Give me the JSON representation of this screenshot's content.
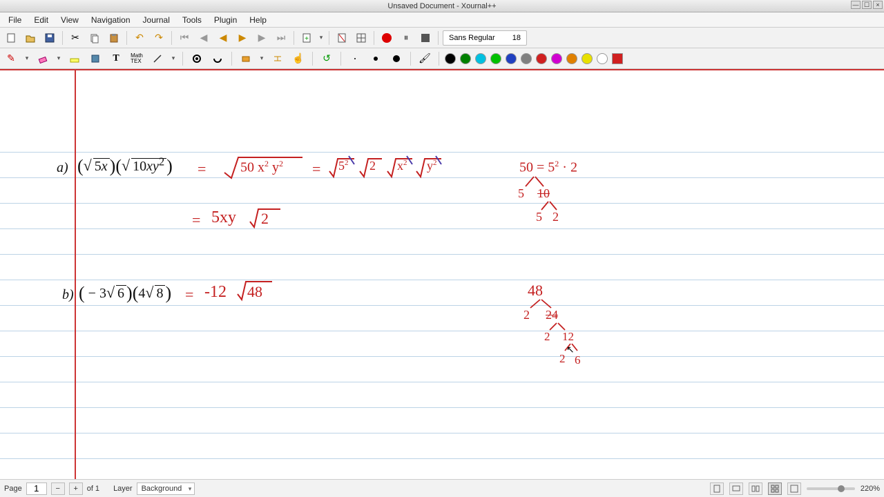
{
  "window": {
    "title": "Unsaved Document - Xournal++",
    "min": "—",
    "max": "☐",
    "close": "×"
  },
  "menu": {
    "file": "File",
    "edit": "Edit",
    "view": "View",
    "navigation": "Navigation",
    "journal": "Journal",
    "tools": "Tools",
    "plugin": "Plugin",
    "help": "Help"
  },
  "toolbar": {
    "font_name": "Sans Regular",
    "font_size": "18"
  },
  "colors": {
    "palette": [
      "#000000",
      "#008000",
      "#00c0c0",
      "#00a000",
      "#0030c0",
      "#808080",
      "#d02020",
      "#d000c0",
      "#e08000",
      "#e0d000",
      "#ffffff"
    ],
    "fill": "#d02020"
  },
  "status": {
    "page_label": "Page",
    "page_current": "1",
    "page_total": "of 1",
    "layer_label": "Layer",
    "layer_name": "Background",
    "zoom": "220%"
  },
  "content": {
    "problem_a_label": "a)",
    "problem_a_expr": "(√5x)(√10xy²)",
    "problem_b_label": "b)",
    "problem_b_expr": "(− 3√6)(4√8)",
    "eq": "=",
    "a_step1": "√(50 x² y²)",
    "a_step2": "√5² √2 √x² √y²",
    "a_step3": "5xy √2",
    "a_side1": "50 = 5² · 2",
    "a_side2a": "5",
    "a_side2b": "10",
    "a_side3a": "5",
    "a_side3b": "2",
    "b_step1": "-12 √48",
    "b_side1": "48",
    "b_side2a": "2",
    "b_side2b": "24",
    "b_side3a": "2",
    "b_side3b": "12",
    "b_side4a": "2",
    "b_side4b": "6"
  }
}
